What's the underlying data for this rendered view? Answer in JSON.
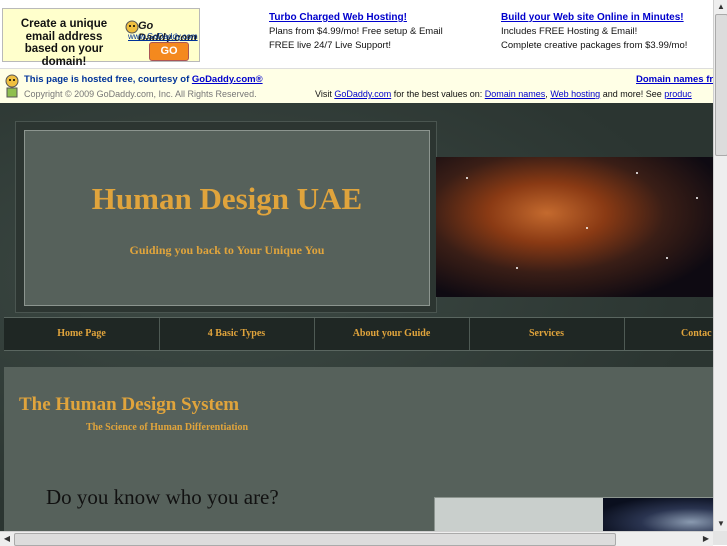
{
  "ad": {
    "box_text": "Create a unique email address based on your domain!",
    "logo_word": "Go Daddy.com",
    "logo_url": "www.GoDaddy.com",
    "go_label": "GO",
    "col1": {
      "link": "Turbo Charged Web Hosting!",
      "line1": "Plans from $4.99/mo! Free setup & Email",
      "line2": "FREE live 24/7 Live Support!"
    },
    "col2": {
      "link": "Build your Web site Online in Minutes!",
      "line1": "Includes FREE Hosting & Email!",
      "line2": "Complete creative packages from $3.99/mo!"
    }
  },
  "hosted": {
    "prefix": "This page is hosted free, courtesy of ",
    "link": "GoDaddy.com®",
    "copyright": "Copyright © 2009 GoDaddy.com, Inc. All Rights Reserved.",
    "visit_prefix": "Visit ",
    "visit_link": "GoDaddy.com",
    "visit_mid": " for the best values on: ",
    "domain_link": "Domain names",
    "comma": ", ",
    "hosting_link": "Web hosting",
    "visit_end": " and more! See ",
    "products_link": "produc",
    "domain_names_right": "Domain names fr"
  },
  "site": {
    "title": "Human Design UAE",
    "tagline": "Guiding you back to Your Unique You",
    "nav": [
      "Home Page",
      "4 Basic Types",
      "About your Guide",
      "Services",
      "Contac"
    ],
    "heading": "The Human Design System",
    "subheading": "The Science of Human Differentiation",
    "question": "Do you know who you are?"
  },
  "scroll": {
    "up": "▲",
    "down": "▼",
    "left": "◀",
    "right": "▶"
  }
}
